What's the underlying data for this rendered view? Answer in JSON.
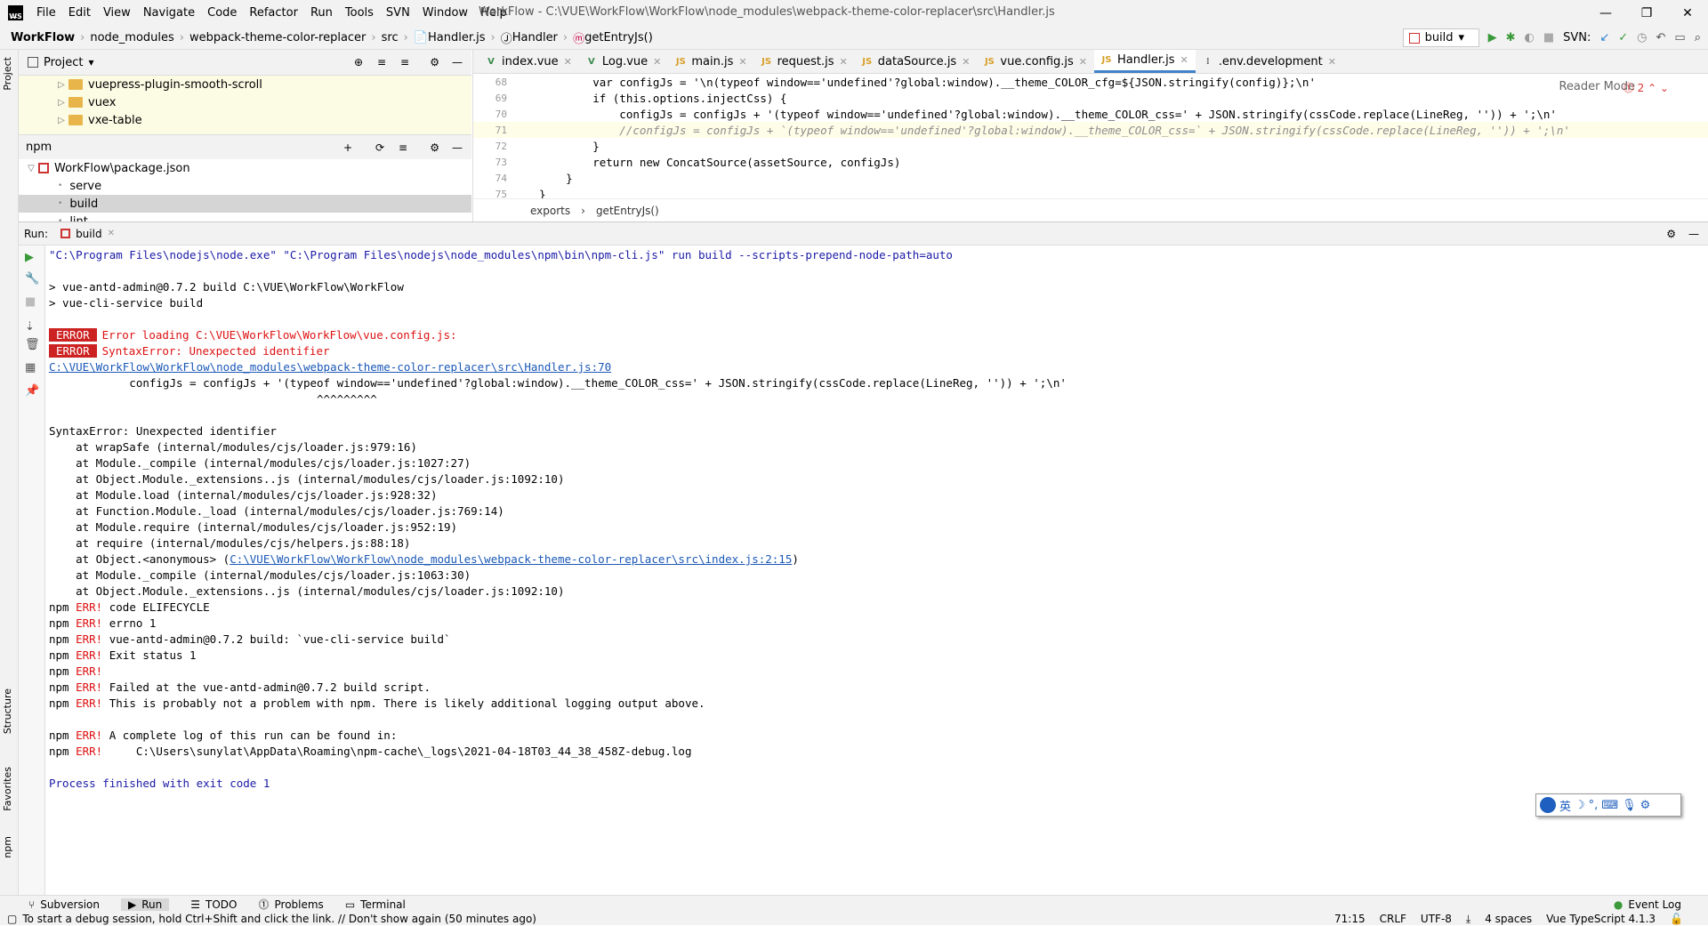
{
  "titlebar": {
    "app_icon": "WS",
    "menu": [
      "File",
      "Edit",
      "View",
      "Navigate",
      "Code",
      "Refactor",
      "Run",
      "Tools",
      "SVN",
      "Window",
      "Help"
    ],
    "title": "WorkFlow - C:\\VUE\\WorkFlow\\WorkFlow\\node_modules\\webpack-theme-color-replacer\\src\\Handler.js"
  },
  "breadcrumb": {
    "items": [
      "WorkFlow",
      "node_modules",
      "webpack-theme-color-replacer",
      "src",
      "Handler.js",
      "Handler",
      "getEntryJs()"
    ]
  },
  "runconfig": {
    "label": "build",
    "svn_label": "SVN:"
  },
  "left_strip": {
    "project": "Project",
    "structure": "Structure",
    "favorites": "Favorites",
    "npm": "npm"
  },
  "project_panel": {
    "title": "Project",
    "folders": [
      "vuepress-plugin-smooth-scroll",
      "vuex",
      "vxe-table"
    ]
  },
  "npm_panel": {
    "title": "npm",
    "package": "WorkFlow\\package.json",
    "scripts": [
      "serve",
      "build",
      "lint"
    ],
    "selected": "build"
  },
  "editor": {
    "tabs": [
      {
        "label": "index.vue",
        "active": false
      },
      {
        "label": "Log.vue",
        "active": false
      },
      {
        "label": "main.js",
        "active": false
      },
      {
        "label": "request.js",
        "active": false
      },
      {
        "label": "dataSource.js",
        "active": false
      },
      {
        "label": "vue.config.js",
        "active": false
      },
      {
        "label": "Handler.js",
        "active": true
      },
      {
        "label": ".env.development",
        "active": false
      }
    ],
    "reader_mode": "Reader Mode",
    "error_count": "2",
    "line_numbers": [
      "68",
      "69",
      "70",
      "71",
      "72",
      "73",
      "74",
      "75"
    ],
    "lines": [
      "        var configJs = '\\n(typeof window=='undefined'?global:window).__theme_COLOR_cfg=${JSON.stringify(config)};\\n'",
      "        if (this.options.injectCss) {",
      "            configJs = configJs + '(typeof window=='undefined'?global:window).__theme_COLOR_css=' + JSON.stringify(cssCode.replace(LineReg, '')) + ';\\n'",
      "            //configJs = configJs + `(typeof window=='undefined'?global:window).__theme_COLOR_css=` + JSON.stringify(cssCode.replace(LineReg, '')) + ';\\n'",
      "        }",
      "        return new ConcatSource(assetSource, configJs)",
      "    }",
      "}"
    ],
    "code_crumb": [
      "exports",
      "getEntryJs()"
    ]
  },
  "run_panel": {
    "label": "Run:",
    "tab": "build"
  },
  "console": [
    {
      "t": "\"C:\\Program Files\\nodejs\\node.exe\" \"C:\\Program Files\\nodejs\\node_modules\\npm\\bin\\npm-cli.js\" run build --scripts-prepend-node-path=auto",
      "c": "blue"
    },
    {
      "t": "",
      "c": ""
    },
    {
      "t": "> vue-antd-admin@0.7.2 build C:\\VUE\\WorkFlow\\WorkFlow",
      "c": ""
    },
    {
      "t": "> vue-cli-service build",
      "c": ""
    },
    {
      "t": "",
      "c": ""
    },
    {
      "t": "Error loading C:\\VUE\\WorkFlow\\WorkFlow\\vue.config.js:",
      "c": "red",
      "badge": "ERROR"
    },
    {
      "t": "SyntaxError: Unexpected identifier",
      "c": "red",
      "badge": "ERROR"
    },
    {
      "t": "C:\\VUE\\WorkFlow\\WorkFlow\\node_modules\\webpack-theme-color-replacer\\src\\Handler.js:70",
      "c": "lnk"
    },
    {
      "t": "            configJs = configJs + '(typeof window=='undefined'?global:window).__theme_COLOR_css=' + JSON.stringify(cssCode.replace(LineReg, '')) + ';\\n'",
      "c": ""
    },
    {
      "t": "                                        ^^^^^^^^^",
      "c": ""
    },
    {
      "t": "",
      "c": ""
    },
    {
      "t": "SyntaxError: Unexpected identifier",
      "c": ""
    },
    {
      "t": "    at wrapSafe (internal/modules/cjs/loader.js:979:16)",
      "c": ""
    },
    {
      "t": "    at Module._compile (internal/modules/cjs/loader.js:1027:27)",
      "c": ""
    },
    {
      "t": "    at Object.Module._extensions..js (internal/modules/cjs/loader.js:1092:10)",
      "c": ""
    },
    {
      "t": "    at Module.load (internal/modules/cjs/loader.js:928:32)",
      "c": ""
    },
    {
      "t": "    at Function.Module._load (internal/modules/cjs/loader.js:769:14)",
      "c": ""
    },
    {
      "t": "    at Module.require (internal/modules/cjs/loader.js:952:19)",
      "c": ""
    },
    {
      "t": "    at require (internal/modules/cjs/helpers.js:88:18)",
      "c": ""
    },
    {
      "t": "    at Object.<anonymous> (",
      "c": "",
      "link": "C:\\VUE\\WorkFlow\\WorkFlow\\node_modules\\webpack-theme-color-replacer\\src\\index.js:2:15",
      "after": ")"
    },
    {
      "t": "    at Module._compile (internal/modules/cjs/loader.js:1063:30)",
      "c": ""
    },
    {
      "t": "    at Object.Module._extensions..js (internal/modules/cjs/loader.js:1092:10)",
      "c": ""
    },
    {
      "t": "npm ",
      "c": "",
      "err": "ERR!",
      "rest": " code ELIFECYCLE"
    },
    {
      "t": "npm ",
      "c": "",
      "err": "ERR!",
      "rest": " errno 1"
    },
    {
      "t": "npm ",
      "c": "",
      "err": "ERR!",
      "rest": " vue-antd-admin@0.7.2 build: `vue-cli-service build`"
    },
    {
      "t": "npm ",
      "c": "",
      "err": "ERR!",
      "rest": " Exit status 1"
    },
    {
      "t": "npm ",
      "c": "",
      "err": "ERR!",
      "rest": ""
    },
    {
      "t": "npm ",
      "c": "",
      "err": "ERR!",
      "rest": " Failed at the vue-antd-admin@0.7.2 build script."
    },
    {
      "t": "npm ",
      "c": "",
      "err": "ERR!",
      "rest": " This is probably not a problem with npm. There is likely additional logging output above."
    },
    {
      "t": "",
      "c": ""
    },
    {
      "t": "npm ",
      "c": "",
      "err": "ERR!",
      "rest": " A complete log of this run can be found in:"
    },
    {
      "t": "npm ",
      "c": "",
      "err": "ERR!",
      "rest": "     C:\\Users\\sunylat\\AppData\\Roaming\\npm-cache\\_logs\\2021-04-18T03_44_38_458Z-debug.log"
    },
    {
      "t": "",
      "c": ""
    },
    {
      "t": "Process finished with exit code 1",
      "c": "blue"
    }
  ],
  "ime": {
    "label": "英"
  },
  "bottom_tabs": [
    "Subversion",
    "Run",
    "TODO",
    "Problems",
    "Terminal"
  ],
  "event_log": "Event Log",
  "status": {
    "message": "To start a debug session, hold Ctrl+Shift and click the link. // Don't show again (50 minutes ago)",
    "position": "71:15",
    "line_sep": "CRLF",
    "encoding": "UTF-8",
    "indent": "4 spaces",
    "lang": "Vue TypeScript 4.1.3"
  },
  "colors": {
    "accent": "#4083c9",
    "error": "#dd1111",
    "link": "#1a58b6"
  }
}
